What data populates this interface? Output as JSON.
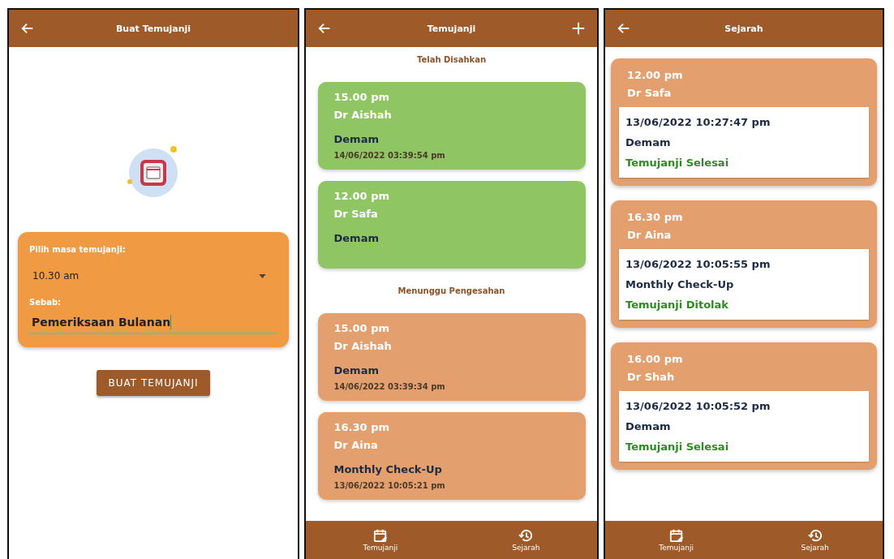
{
  "screens": [
    {
      "kind": "form",
      "title": "Buat Temujanji",
      "form": {
        "time_label": "Pilih masa temujanji:",
        "time_value": "10.30 am",
        "reason_label": "Sebab:",
        "reason_value": "Pemeriksaan Bulanan"
      },
      "button": "BUAT TEMUJANJI"
    },
    {
      "kind": "list",
      "title": "Temujanji",
      "sections": [
        {
          "heading": "Telah Disahkan",
          "color": "#8fc563",
          "cards": [
            {
              "time": "15.00 pm",
              "doctor": "Dr Aishah",
              "reason": "Demam",
              "date": "14/06/2022 03:39:54 pm"
            },
            {
              "time": "12.00 pm",
              "doctor": "Dr Safa",
              "reason": "Demam"
            }
          ]
        },
        {
          "heading": "Menunggu Pengesahan",
          "color": "#e3a06e",
          "cards": [
            {
              "time": "15.00 pm",
              "doctor": "Dr Aishah",
              "reason": "Demam",
              "date": "14/06/2022 03:39:34 pm"
            },
            {
              "time": "16.30 pm",
              "doctor": "Dr Aina",
              "reason": "Monthly Check-Up",
              "date": "13/06/2022 10:05:21 pm"
            }
          ]
        }
      ],
      "nav": [
        "Temujanji",
        "Sejarah"
      ]
    },
    {
      "kind": "history",
      "title": "Sejarah",
      "cards": [
        {
          "time": "12.00 pm",
          "doctor": "Dr Safa",
          "date": "13/06/2022 10:27:47 pm",
          "reason": "Demam",
          "status": "Temujanji Selesai"
        },
        {
          "time": "16.30 pm",
          "doctor": "Dr Aina",
          "date": "13/06/2022 10:05:55 pm",
          "reason": "Monthly Check-Up",
          "status": "Temujanji Ditolak"
        },
        {
          "time": "16.00 pm",
          "doctor": "Dr Shah",
          "date": "13/06/2022 10:05:52 pm",
          "reason": "Demam",
          "status": "Temujanji Selesai"
        }
      ],
      "nav": [
        "Temujanji",
        "Sejarah"
      ]
    }
  ]
}
